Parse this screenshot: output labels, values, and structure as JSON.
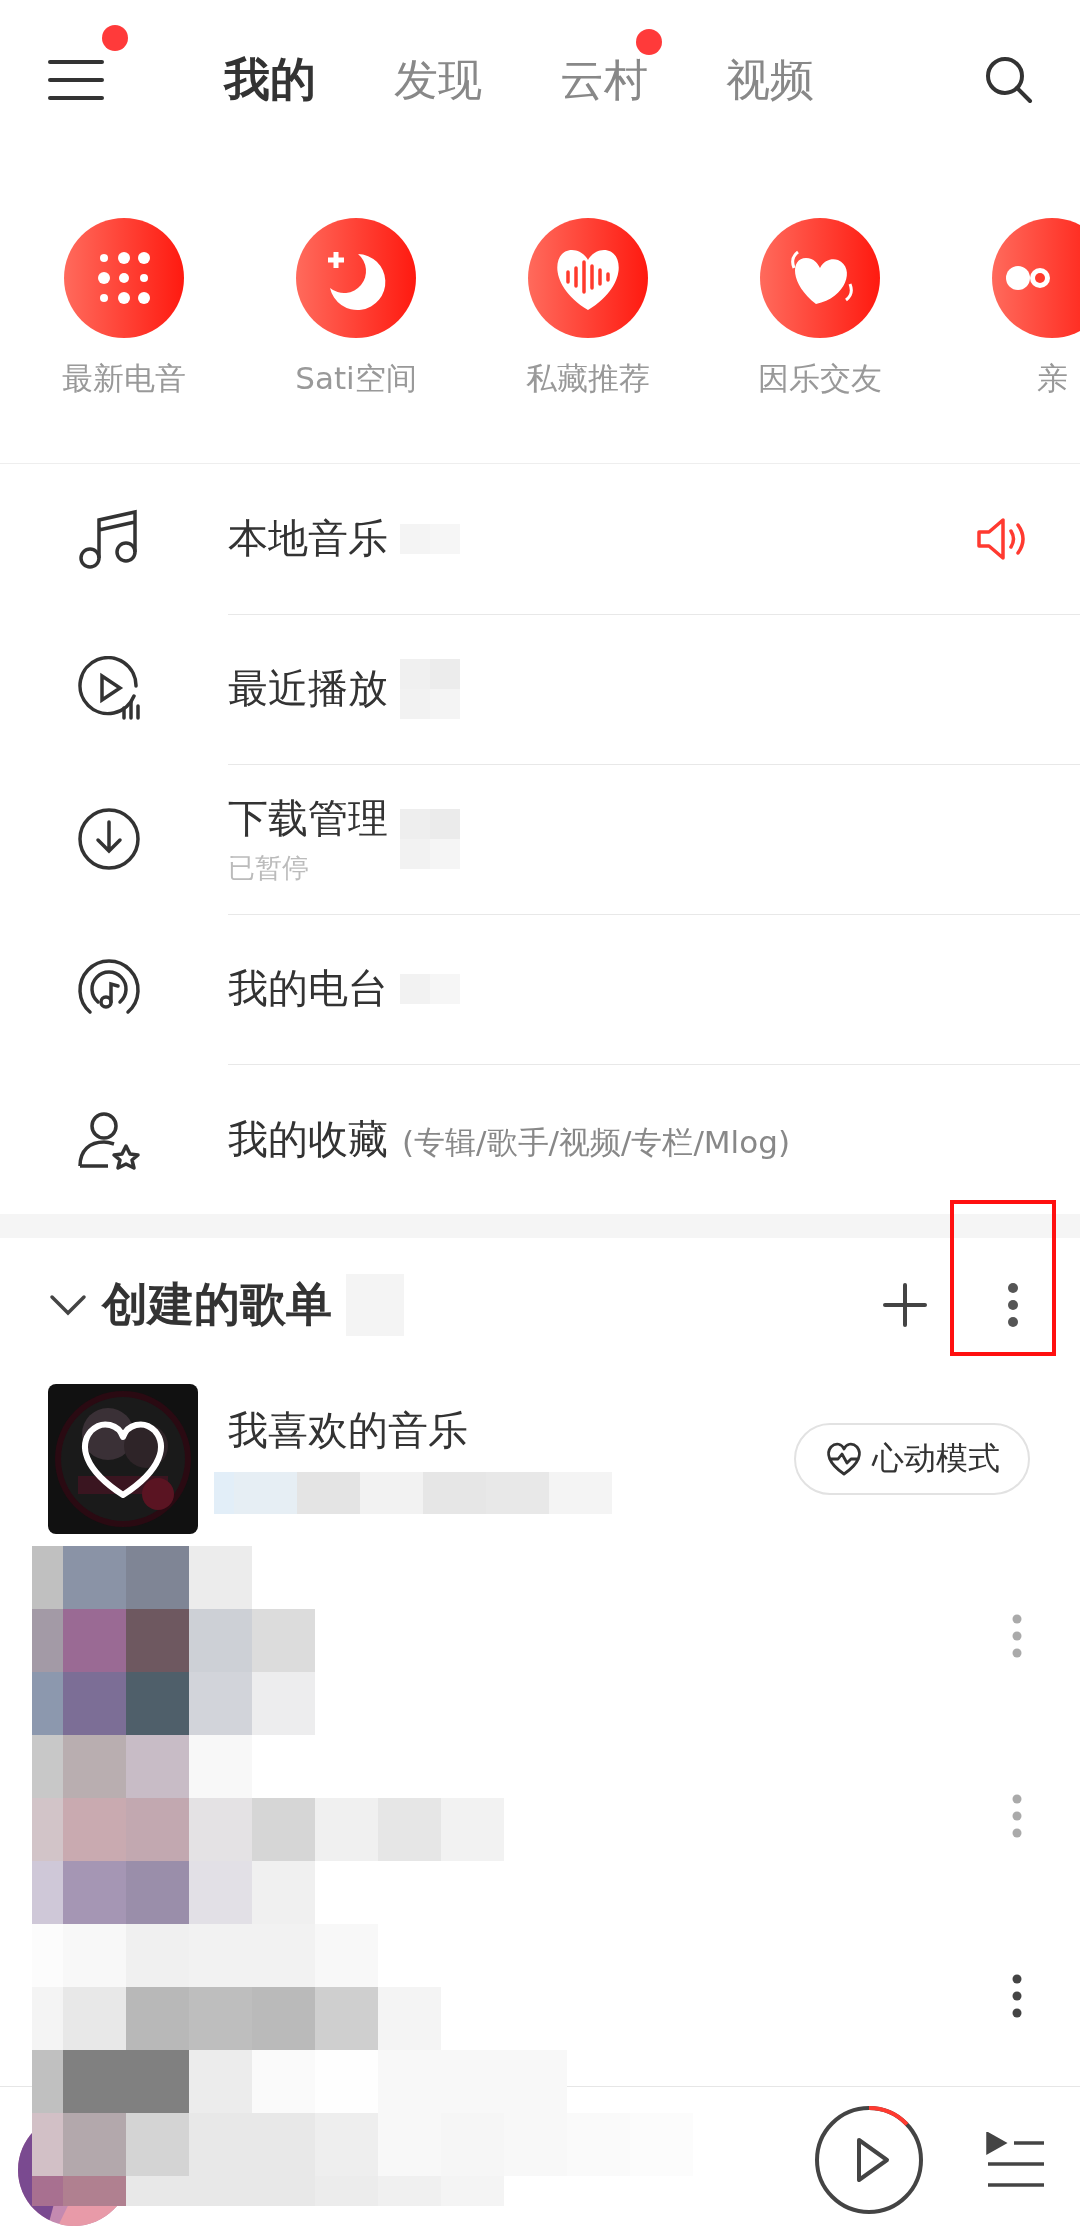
{
  "top_bar": {
    "menu_badge": true,
    "tabs": [
      {
        "label": "我的",
        "selected": true,
        "badge": false
      },
      {
        "label": "发现",
        "selected": false,
        "badge": false
      },
      {
        "label": "云村",
        "selected": false,
        "badge": true
      },
      {
        "label": "视频",
        "selected": false,
        "badge": false
      }
    ]
  },
  "shortcuts": [
    {
      "label": "最新电音"
    },
    {
      "label": "Sati空间"
    },
    {
      "label": "私藏推荐"
    },
    {
      "label": "因乐交友"
    },
    {
      "label": "亲"
    }
  ],
  "library": [
    {
      "title": "本地音乐",
      "playing": true
    },
    {
      "title": "最近播放",
      "playing": false
    },
    {
      "title": "下载管理",
      "subtitle": "已暂停",
      "playing": false
    },
    {
      "title": "我的电台",
      "playing": false
    },
    {
      "title": "我的收藏",
      "note": "(专辑/歌手/视频/专栏/Mlog)",
      "playing": false
    }
  ],
  "created_playlists": {
    "title": "创建的歌单",
    "expanded": true,
    "more_highlighted": true,
    "items": [
      {
        "kind": "liked",
        "title": "我喜欢的音乐",
        "action": "心动模式"
      },
      {
        "kind": "blurred"
      },
      {
        "kind": "blurred"
      },
      {
        "kind": "blurred"
      }
    ]
  },
  "player": {
    "level": 0.13
  }
}
